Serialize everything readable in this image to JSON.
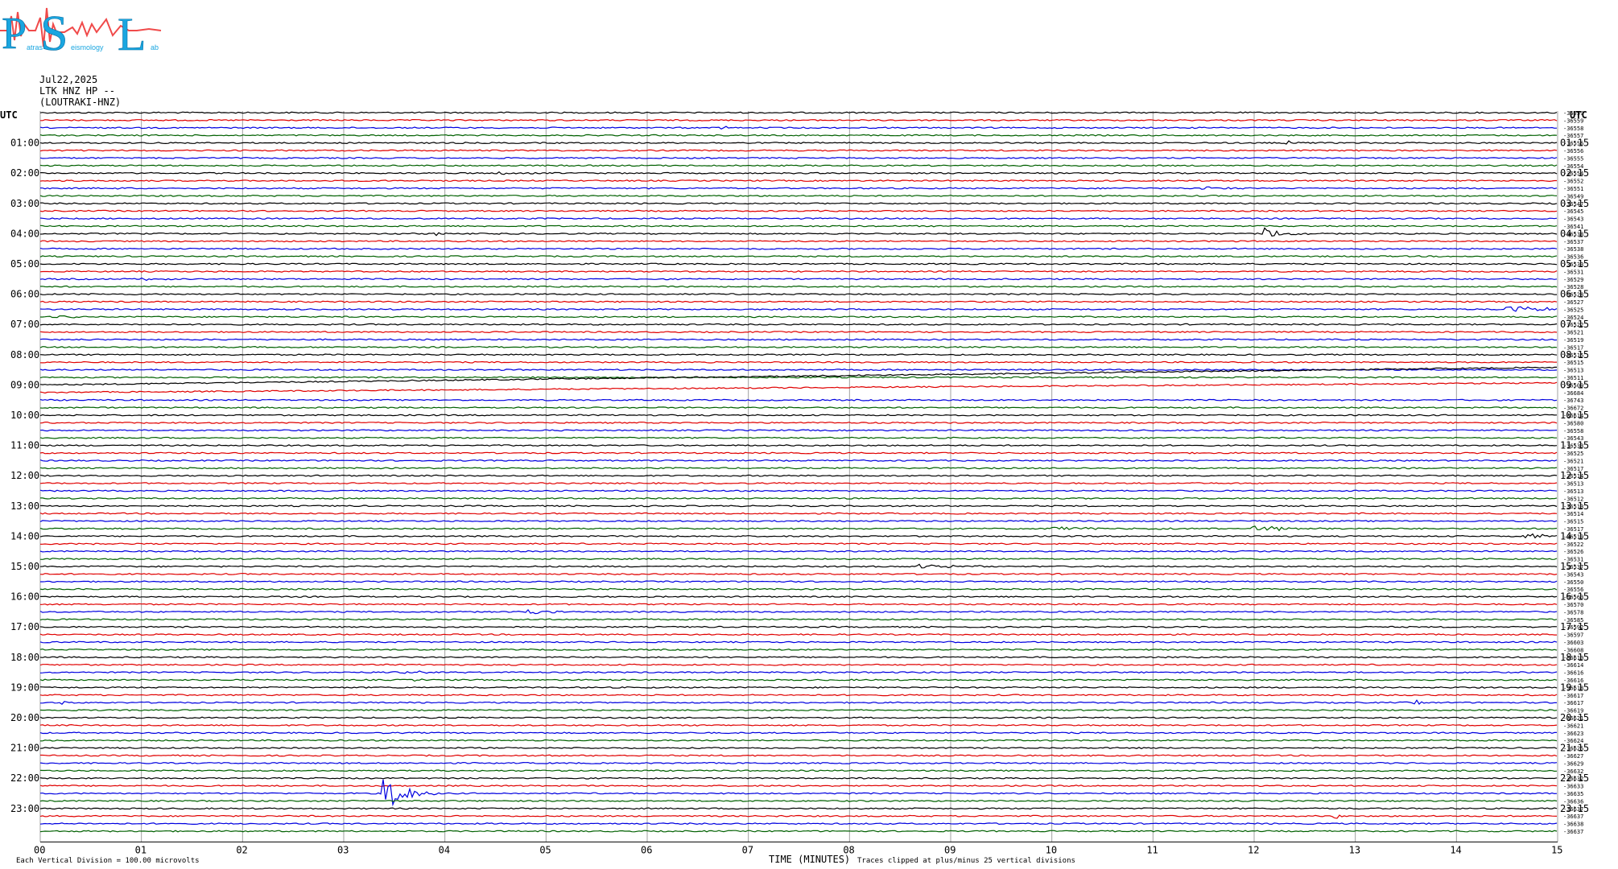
{
  "logo": {
    "letters": [
      "P",
      "S",
      "L"
    ],
    "words": [
      "atras",
      "eismology",
      "ab"
    ],
    "colors": {
      "letters": "#1aa6e0",
      "trace": "#f04a4a"
    }
  },
  "header": {
    "date": "Jul22,2025",
    "station": "LTK HNZ HP --",
    "name": "(LOUTRAKI-HNZ)"
  },
  "axis": {
    "utc_label": "UTC",
    "left_hours": [
      "01:00",
      "02:00",
      "03:00",
      "04:00",
      "05:00",
      "06:00",
      "07:00",
      "08:00",
      "09:00",
      "10:00",
      "11:00",
      "12:00",
      "13:00",
      "14:00",
      "15:00",
      "16:00",
      "17:00",
      "18:00",
      "19:00",
      "20:00",
      "21:00",
      "22:00",
      "23:00"
    ],
    "right_hours": [
      "01:15",
      "02:15",
      "03:15",
      "04:15",
      "05:15",
      "06:15",
      "07:15",
      "08:15",
      "09:15",
      "10:15",
      "11:15",
      "12:15",
      "13:15",
      "14:15",
      "15:15",
      "16:15",
      "17:15",
      "18:15",
      "19:15",
      "20:15",
      "21:15",
      "22:15",
      "23:15"
    ],
    "x_ticks": [
      "00",
      "01",
      "02",
      "03",
      "04",
      "05",
      "06",
      "07",
      "08",
      "09",
      "10",
      "11",
      "12",
      "13",
      "14",
      "15"
    ],
    "x_title": "TIME (MINUTES)",
    "footer_left": "Each Vertical Division =  100.00 microvolts",
    "footer_right": "Traces clipped at plus/minus 25 vertical divisions"
  },
  "chart_data": {
    "type": "line",
    "x_unit": "minutes",
    "xlim": [
      0,
      15
    ],
    "traces_per_hour": 4,
    "trace_count": 96,
    "color_cycle": [
      "#000000",
      "#e00000",
      "#0000e0",
      "#006000"
    ],
    "offsets": [
      "-36559",
      "-36559",
      "-36558",
      "-36557",
      "-36556",
      "-36556",
      "-36555",
      "-36554",
      "-36554",
      "-36552",
      "-36551",
      "-36549",
      "-36547",
      "-36545",
      "-36543",
      "-36541",
      "-36538",
      "-36537",
      "-36538",
      "-36536",
      "-36533",
      "-36531",
      "-36529",
      "-36528",
      "-36528",
      "-36527",
      "-36525",
      "-36524",
      "-36522",
      "-36521",
      "-36519",
      "-36517",
      "-36515",
      "-36515",
      "-36513",
      "-36511",
      "-36509",
      "-36684",
      "-36743",
      "-36672",
      "-36614",
      "-36580",
      "-36558",
      "-36543",
      "-36533",
      "-36525",
      "-36521",
      "-36517",
      "-36514",
      "-36513",
      "-36513",
      "-36512",
      "-36513",
      "-36514",
      "-36515",
      "-36517",
      "-36519",
      "-36522",
      "-36526",
      "-36531",
      "-36537",
      "-36543",
      "-36550",
      "-36556",
      "-36563",
      "-36570",
      "-36578",
      "-36585",
      "-36592",
      "-36597",
      "-36603",
      "-36608",
      "-36610",
      "-36614",
      "-36616",
      "-36616",
      "-36618",
      "-36617",
      "-36617",
      "-36619",
      "-36621",
      "-36621",
      "-36623",
      "-36624",
      "-36625",
      "-36627",
      "-36629",
      "-36632",
      "-36632",
      "-36633",
      "-36635",
      "-36636",
      "-36637",
      "-36637",
      "-36638",
      "-36637"
    ],
    "events": [
      {
        "trace": 2,
        "minute": 6.75,
        "amp": 3,
        "dur": 0.15
      },
      {
        "trace": 4,
        "minute": 12.3,
        "amp": 4,
        "dur": 0.15
      },
      {
        "trace": 8,
        "minute": 4.5,
        "amp": 2,
        "dur": 0.3
      },
      {
        "trace": 10,
        "minute": 0.75,
        "amp": 2,
        "dur": 0.1
      },
      {
        "trace": 10,
        "minute": 11.5,
        "amp": 2,
        "dur": 0.5
      },
      {
        "trace": 16,
        "minute": 3.9,
        "amp": 2,
        "dur": 0.3
      },
      {
        "trace": 16,
        "minute": 12.1,
        "amp": 8,
        "dur": 0.35
      },
      {
        "trace": 22,
        "minute": 1.0,
        "amp": 2,
        "dur": 0.3
      },
      {
        "trace": 26,
        "minute": 14.5,
        "amp": 4,
        "dur": 1.1
      },
      {
        "trace": 27,
        "minute": 0.2,
        "amp": 2,
        "dur": 0.3
      },
      {
        "trace": 27,
        "minute": 12.4,
        "amp": 2,
        "dur": 0.2
      },
      {
        "trace": 55,
        "minute": 10.0,
        "amp": 2,
        "dur": 1.5
      },
      {
        "trace": 55,
        "minute": 12.0,
        "amp": 5,
        "dur": 0.55
      },
      {
        "trace": 56,
        "minute": 14.7,
        "amp": 3,
        "dur": 0.6
      },
      {
        "trace": 57,
        "minute": 0.5,
        "amp": 2,
        "dur": 0.4
      },
      {
        "trace": 60,
        "minute": 8.7,
        "amp": 3,
        "dur": 0.7
      },
      {
        "trace": 66,
        "minute": 4.8,
        "amp": 3,
        "dur": 0.4
      },
      {
        "trace": 74,
        "minute": 3.5,
        "amp": 2,
        "dur": 0.7
      },
      {
        "trace": 75,
        "minute": 3.7,
        "amp": 2,
        "dur": 0.1
      },
      {
        "trace": 78,
        "minute": 0.2,
        "amp": 3,
        "dur": 0.1
      },
      {
        "trace": 78,
        "minute": 13.6,
        "amp": 3,
        "dur": 0.1
      },
      {
        "trace": 90,
        "minute": 3.4,
        "amp": 28,
        "dur": 0.35
      },
      {
        "trace": 93,
        "minute": 7.2,
        "amp": 2,
        "dur": 0.1
      },
      {
        "trace": 93,
        "minute": 12.8,
        "amp": 3,
        "dur": 0.15
      }
    ],
    "drifts": [
      {
        "trace": 36,
        "start_min": 0,
        "end_min": 15,
        "rise": 22
      },
      {
        "trace": 37,
        "start_min": 0,
        "end_min": 15,
        "rise": 12
      }
    ]
  }
}
